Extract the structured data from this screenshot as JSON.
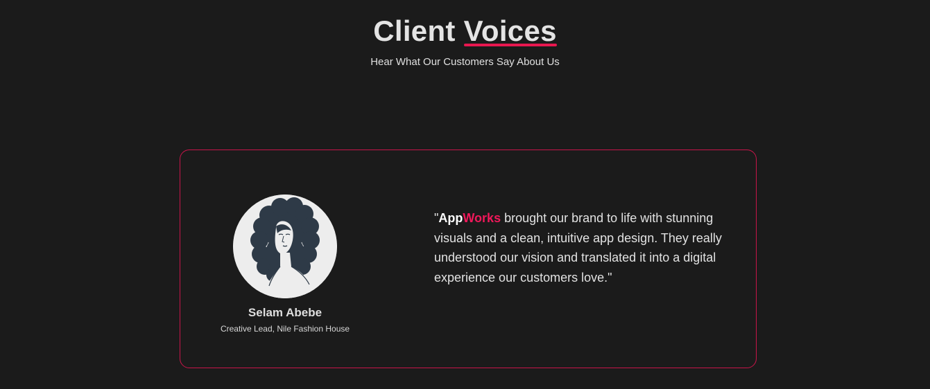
{
  "section": {
    "title_part1": "Client ",
    "title_part2": "Voices",
    "subtitle": "Hear What Our Customers Say About Us"
  },
  "testimonial": {
    "name": "Selam Abebe",
    "role": "Creative Lead, Nile Fashion House",
    "quote_open": "\"",
    "brand_part1": "App",
    "brand_part2": "Works",
    "quote_body": " brought our brand to life with stunning visuals and a clean, intuitive app design. They really understood our vision and translated it into a digital experience our customers love.\"",
    "avatar_icon": "woman-curly-hair-illustration"
  },
  "colors": {
    "background": "#1b1b1b",
    "accent": "#e8174f",
    "card_border": "#c9154a"
  }
}
